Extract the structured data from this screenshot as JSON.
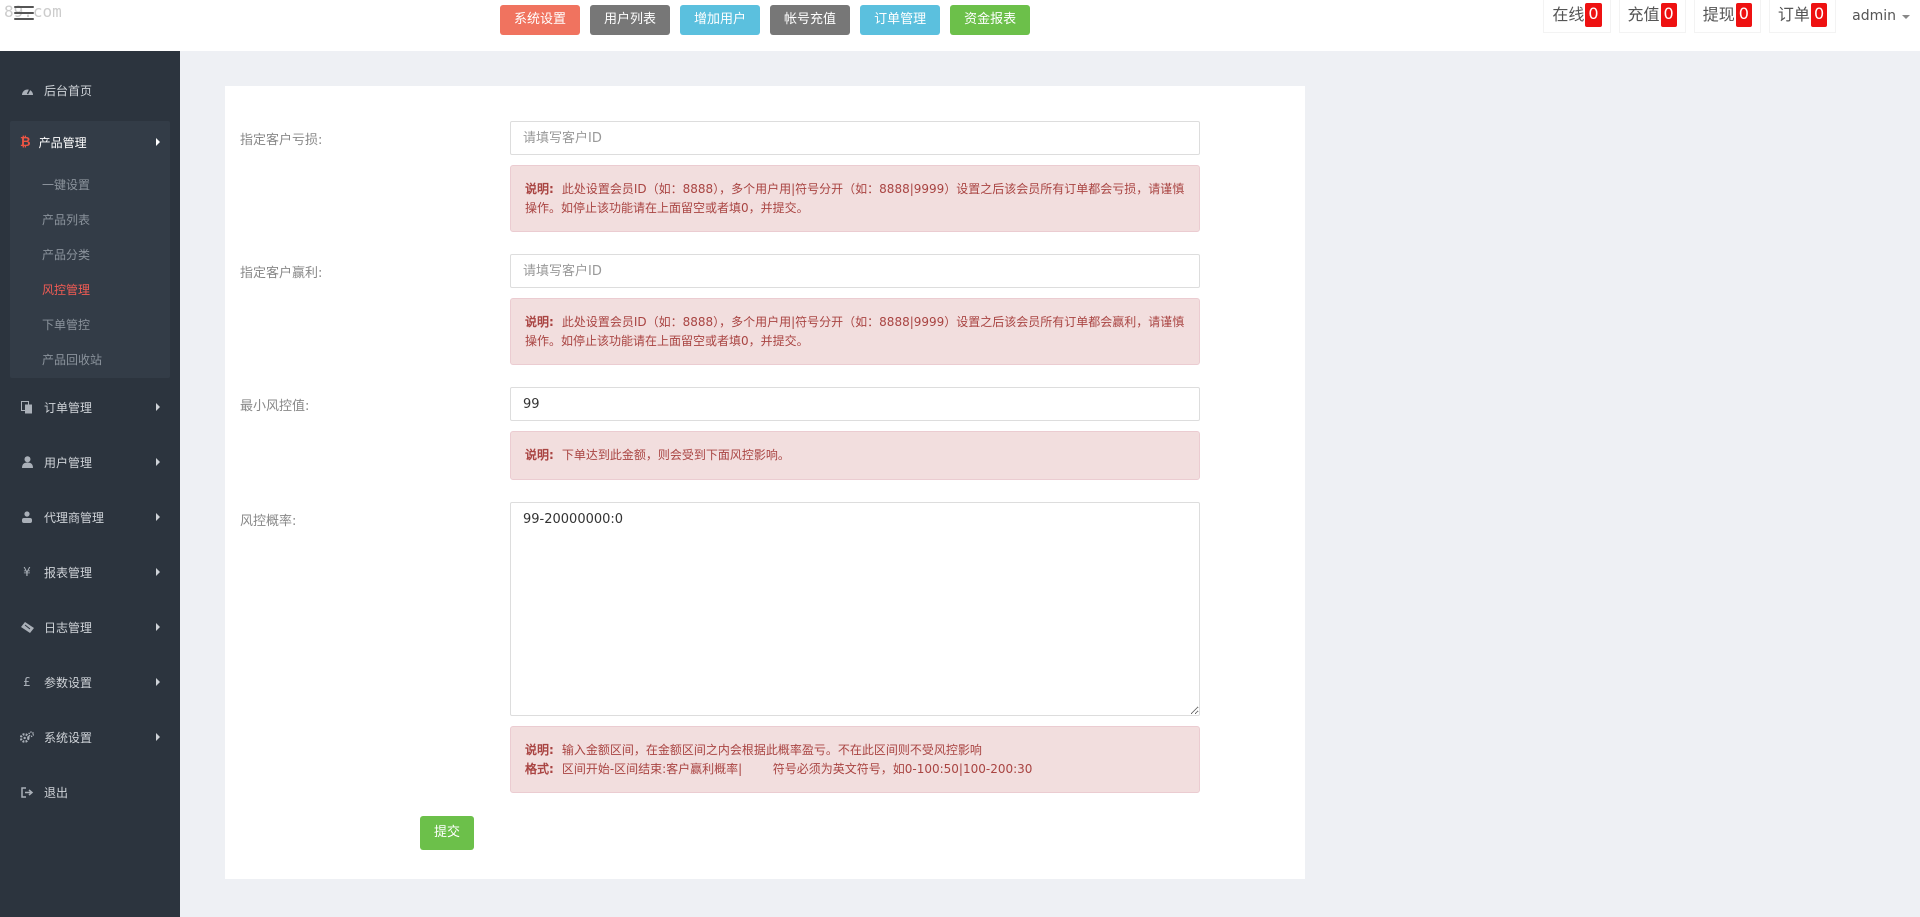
{
  "watermark": "89.com",
  "topnav": [
    {
      "label": "系统设置",
      "color": "#f0735f"
    },
    {
      "label": "用户列表",
      "color": "#777777"
    },
    {
      "label": "增加用户",
      "color": "#5bc0de"
    },
    {
      "label": "帐号充值",
      "color": "#777777"
    },
    {
      "label": "订单管理",
      "color": "#5bc0de"
    },
    {
      "label": "资金报表",
      "color": "#6cc04a"
    }
  ],
  "stats": [
    {
      "label": "在线",
      "count": "0"
    },
    {
      "label": "充值",
      "count": "0"
    },
    {
      "label": "提现",
      "count": "0"
    },
    {
      "label": "订单",
      "count": "0"
    }
  ],
  "user": "admin",
  "sidebar": {
    "home": "后台首页",
    "product_group": {
      "label": "产品管理",
      "items": [
        "一键设置",
        "产品列表",
        "产品分类",
        "风控管理",
        "下单管控",
        "产品回收站"
      ],
      "active": "风控管理"
    },
    "items": [
      {
        "label": "订单管理",
        "icon": "copy-icon"
      },
      {
        "label": "用户管理",
        "icon": "user-icon"
      },
      {
        "label": "代理商管理",
        "icon": "sitemap-icon"
      },
      {
        "label": "报表管理",
        "icon": "yen-icon"
      },
      {
        "label": "日志管理",
        "icon": "ticket-icon"
      },
      {
        "label": "参数设置",
        "icon": "pound-icon"
      },
      {
        "label": "系统设置",
        "icon": "cogs-icon"
      }
    ],
    "logout": "退出"
  },
  "form": {
    "loss": {
      "label": "指定客户亏损:",
      "placeholder": "请填写客户ID",
      "note_title": "说明:",
      "note_text": "此处设置会员ID（如：8888），多个用户用|符号分开（如：8888|9999）设置之后该会员所有订单都会亏损，请谨慎操作。如停止该功能请在上面留空或者填0，并提交。"
    },
    "profit": {
      "label": "指定客户赢利:",
      "placeholder": "请填写客户ID",
      "note_title": "说明:",
      "note_text": "此处设置会员ID（如：8888），多个用户用|符号分开（如：8888|9999）设置之后该会员所有订单都会赢利，请谨慎操作。如停止该功能请在上面留空或者填0，并提交。"
    },
    "min": {
      "label": "最小风控值:",
      "value": "99",
      "note_title": "说明:",
      "note_text": "下单达到此金额，则会受到下面风控影响。"
    },
    "prob": {
      "label": "风控概率:",
      "value": "99-20000000:0",
      "note_title": "说明:",
      "note_text": "输入金额区间，在金额区间之内会根据此概率盈亏。不在此区间则不受风控影响",
      "format_title": "格式:",
      "format_text": "区间开始-区间结束:客户赢利概率|        符号必须为英文符号，如0-100:50|100-200:30"
    },
    "submit": "提交"
  }
}
